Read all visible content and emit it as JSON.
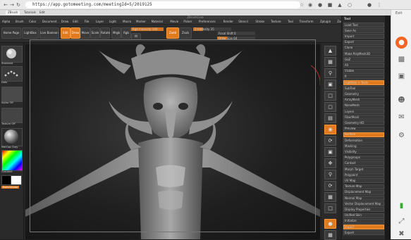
{
  "browser": {
    "url": "https://app.gotomeeting.com/meetingId=5/2019125",
    "tabs": [
      "ZBrush",
      "Tutorials",
      "Edit"
    ]
  },
  "meeting": {
    "label": "Exit"
  },
  "app": {
    "title": "ZBrushCore",
    "menus": [
      "Alpha",
      "Brush",
      "Color",
      "Document",
      "Draw",
      "Edit",
      "File",
      "Layer",
      "Light",
      "Macro",
      "Marker",
      "Material",
      "Movie",
      "Picker",
      "Preferences",
      "Render",
      "Stencil",
      "Stroke",
      "Texture",
      "Tool",
      "Transform",
      "Zplugin",
      "Zscript",
      "Help"
    ],
    "toolbar": {
      "buttons": [
        "Home Page",
        "LightBox",
        "Live Boolean"
      ],
      "edit": "Edit",
      "draw": "Draw",
      "move": "Move",
      "scale": "Scale",
      "rotate": "Rotate",
      "mrgb": "Mrgb",
      "rgb": "Rgb",
      "m": "M",
      "zadd": "Zadd",
      "zsub": "Zsub",
      "focal_label": "Focal Shift 0",
      "draw_size_label": "Draw Size 64",
      "z_intensity_label": "Z Intensity 25",
      "rgb_intensity_label": "Rgb Intensity 100",
      "focal_shift": 0.0,
      "draw_size": 0.25,
      "z_intensity": 0.25,
      "rgb_intensity": 1.0
    },
    "left_shelf": {
      "labels": [
        "Standard",
        "Dots",
        "Alpha Off",
        "Texture Off",
        "MatCap Gray",
        "Gradient",
        "SwitchColor"
      ]
    },
    "tool_palette": {
      "header": "Tool",
      "items": [
        "Load Tool",
        "Save As",
        "Import",
        "Export",
        "Clone",
        "Make PolyMesh3D",
        "GoZ",
        "All",
        "Visible",
        "R",
        "Lightbox > Tools",
        "SubTool",
        "Geometry",
        "ArrayMesh",
        "NanoMesh",
        "Layers",
        "FiberMesh",
        "Geometry HD",
        "Preview",
        "Surface",
        "Deformation",
        "Masking",
        "Visibility",
        "Polygroups",
        "Contact",
        "Morph Target",
        "Polypaint",
        "UV Map",
        "Texture Map",
        "Displacement Map",
        "Normal Map",
        "Vector Displacement Map",
        "Display Properties",
        "Unified Skin",
        "Initialize",
        "Import",
        "Export"
      ]
    }
  }
}
